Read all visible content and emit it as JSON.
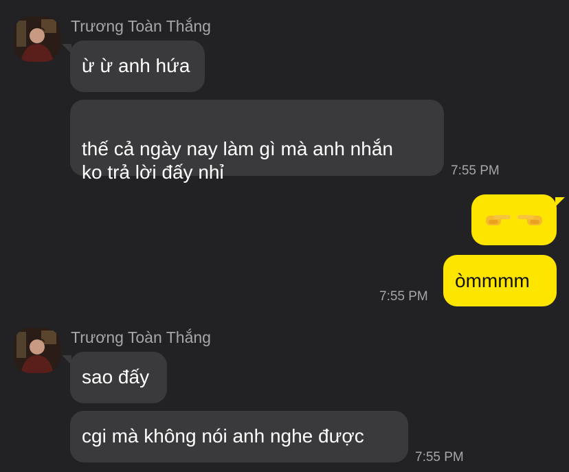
{
  "messages": [
    {
      "sender": "Trương Toàn Thắng",
      "bubbles": [
        "ừ ừ anh hứa",
        "thế cả ngày nay làm gì mà anh nhắn\nko trả lời đấy nhỉ"
      ],
      "time": "7:55 PM"
    },
    {
      "sender": "me",
      "bubbles": [
        "👉👈",
        "òmmmm"
      ],
      "emoji_icons": [
        "pointing-right-icon",
        "pointing-left-icon"
      ],
      "time": "7:55 PM"
    },
    {
      "sender": "Trương Toàn Thắng",
      "bubbles": [
        "sao đấy",
        "cgi mà không nói anh nghe được"
      ],
      "time": "7:55 PM"
    }
  ],
  "colors": {
    "background": "#222224",
    "incoming_bubble": "#3a3a3c",
    "outgoing_bubble": "#fee500",
    "secondary_text": "#a7a7ab"
  }
}
